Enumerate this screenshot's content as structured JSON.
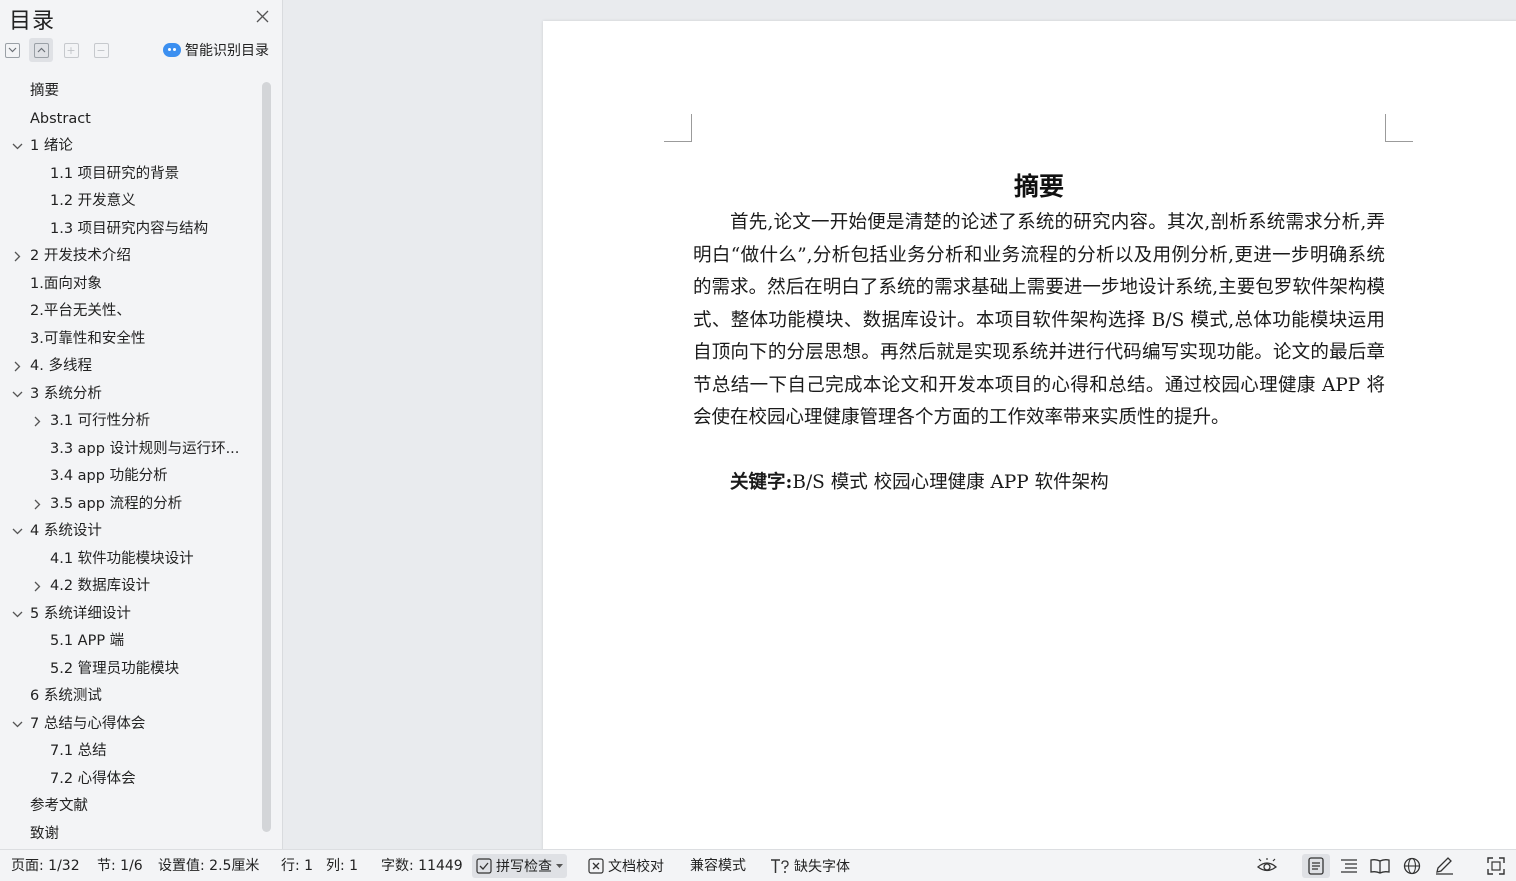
{
  "toc": {
    "title": "目录",
    "smart_label": "智能识别目录",
    "items": [
      {
        "label": "摘要",
        "level": 1,
        "arrow": "none"
      },
      {
        "label": "Abstract",
        "level": 1,
        "arrow": "none"
      },
      {
        "label": "1 绪论",
        "level": 1,
        "arrow": "expanded"
      },
      {
        "label": "1.1 项目研究的背景",
        "level": 2,
        "arrow": "none"
      },
      {
        "label": "1.2 开发意义",
        "level": 2,
        "arrow": "none"
      },
      {
        "label": "1.3 项目研究内容与结构",
        "level": 2,
        "arrow": "none"
      },
      {
        "label": "2 开发技术介绍",
        "level": 1,
        "arrow": "collapsed"
      },
      {
        "label": "1.面向对象",
        "level": 1,
        "arrow": "none"
      },
      {
        "label": "2.平台无关性、",
        "level": 1,
        "arrow": "none"
      },
      {
        "label": "3.可靠性和安全性",
        "level": 1,
        "arrow": "none"
      },
      {
        "label": "4.  多线程",
        "level": 1,
        "arrow": "collapsed"
      },
      {
        "label": "3 系统分析",
        "level": 1,
        "arrow": "expanded"
      },
      {
        "label": "3.1 可行性分析",
        "level": 2,
        "arrow": "collapsed"
      },
      {
        "label": "3.3 app 设计规则与运行环...",
        "level": 2,
        "arrow": "none"
      },
      {
        "label": "3.4 app 功能分析",
        "level": 2,
        "arrow": "none"
      },
      {
        "label": "3.5 app 流程的分析",
        "level": 2,
        "arrow": "collapsed"
      },
      {
        "label": "4 系统设计",
        "level": 1,
        "arrow": "expanded"
      },
      {
        "label": "4.1  软件功能模块设计",
        "level": 2,
        "arrow": "none"
      },
      {
        "label": "4.2  数据库设计",
        "level": 2,
        "arrow": "collapsed"
      },
      {
        "label": "5 系统详细设计",
        "level": 1,
        "arrow": "expanded"
      },
      {
        "label": "5.1 APP 端",
        "level": 2,
        "arrow": "none"
      },
      {
        "label": "5.2 管理员功能模块",
        "level": 2,
        "arrow": "none"
      },
      {
        "label": "6 系统测试",
        "level": 1,
        "arrow": "none"
      },
      {
        "label": "7 总结与心得体会",
        "level": 1,
        "arrow": "expanded"
      },
      {
        "label": "7.1  总结",
        "level": 2,
        "arrow": "none"
      },
      {
        "label": "7.2  心得体会",
        "level": 2,
        "arrow": "none"
      },
      {
        "label": "参考文献",
        "level": 1,
        "arrow": "none"
      },
      {
        "label": "致谢",
        "level": 1,
        "arrow": "none"
      }
    ]
  },
  "document": {
    "heading": "摘要",
    "body": "首先,论文一开始便是清楚的论述了系统的研究内容。其次,剖析系统需求分析,弄明白“做什么”,分析包括业务分析和业务流程的分析以及用例分析,更进一步明确系统的需求。然后在明白了系统的需求基础上需要进一步地设计系统,主要包罗软件架构模式、整体功能模块、数据库设计。本项目软件架构选择 B/S 模式,总体功能模块运用自顶向下的分层思想。再然后就是实现系统并进行代码编写实现功能。论文的最后章节总结一下自己完成本论文和开发本项目的心得和总结。通过校园心理健康 APP 将会使在校园心理健康管理各个方面的工作效率带来实质性的提升。",
    "keywords_label": "关键字:",
    "keywords": "B/S 模式  校园心理健康 APP  软件架构"
  },
  "status_bar": {
    "page": "页面: 1/32",
    "section": "节: 1/6",
    "setting": "设置值: 2.5厘米",
    "row": "行: 1",
    "col": "列: 1",
    "word_count": "字数: 11449",
    "spell_check": "拼写检查",
    "proofread": "文档校对",
    "compat_mode": "兼容模式",
    "missing_font": "缺失字体"
  },
  "colors": {
    "accent": "#3b8ff0",
    "panel_bg": "#f3f4f6",
    "workspace_bg": "#e9ebee"
  }
}
